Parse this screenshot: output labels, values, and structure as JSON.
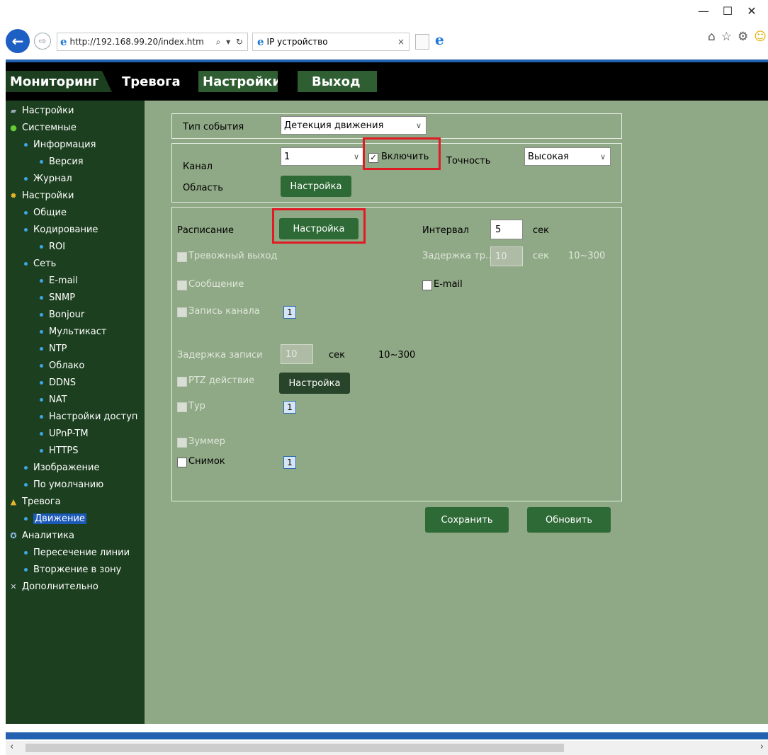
{
  "browser": {
    "url": "http://192.168.99.20/index.htm",
    "tab_title": "IP устройство",
    "tab_close": "×",
    "minimize": "—",
    "maximize": "☐",
    "close": "✕",
    "icons": [
      "home-icon",
      "star-icon",
      "gear-icon",
      "smiley-icon"
    ]
  },
  "nav": {
    "tabs": [
      {
        "label": "Мониторинг"
      },
      {
        "label": "Тревога"
      },
      {
        "label": "Настройки"
      },
      {
        "label": "Выход"
      }
    ]
  },
  "sidebar": {
    "items": [
      {
        "label": "Настройки",
        "level": 0,
        "icon": "book-icon"
      },
      {
        "label": "Системные",
        "level": 0,
        "icon": "info-icon"
      },
      {
        "label": "Информация",
        "level": 1
      },
      {
        "label": "Версия",
        "level": 2
      },
      {
        "label": "Журнал",
        "level": 1
      },
      {
        "label": "Настройки",
        "level": 0,
        "icon": "gear-icon"
      },
      {
        "label": "Общие",
        "level": 1
      },
      {
        "label": "Кодирование",
        "level": 1
      },
      {
        "label": "ROI",
        "level": 2
      },
      {
        "label": "Сеть",
        "level": 1
      },
      {
        "label": "E-mail",
        "level": 2
      },
      {
        "label": "SNMP",
        "level": 2
      },
      {
        "label": "Bonjour",
        "level": 2
      },
      {
        "label": "Мультикаст",
        "level": 2
      },
      {
        "label": "NTP",
        "level": 2
      },
      {
        "label": "Облако",
        "level": 2
      },
      {
        "label": "DDNS",
        "level": 2
      },
      {
        "label": "NAT",
        "level": 2
      },
      {
        "label": "Настройки доступ",
        "level": 2
      },
      {
        "label": "UPnP-TM",
        "level": 2
      },
      {
        "label": "HTTPS",
        "level": 2
      },
      {
        "label": "Изображение",
        "level": 1
      },
      {
        "label": "По умолчанию",
        "level": 1
      },
      {
        "label": "Тревога",
        "level": 0,
        "icon": "bell-icon"
      },
      {
        "label": "Движение",
        "level": 1,
        "selected": true
      },
      {
        "label": "Аналитика",
        "level": 0,
        "icon": "analytics-icon"
      },
      {
        "label": "Пересечение линии",
        "level": 1
      },
      {
        "label": "Вторжение в зону",
        "level": 1
      },
      {
        "label": "Дополнительно",
        "level": 0,
        "icon": "tools-icon"
      }
    ]
  },
  "form": {
    "event_type_label": "Тип события",
    "event_type_value": "Детекция движения",
    "channel_label": "Канал",
    "channel_value": "1",
    "enable_label": "Включить",
    "enable_checked": true,
    "accuracy_label": "Точность",
    "accuracy_value": "Высокая",
    "area_label": "Область",
    "area_button": "Настройка",
    "schedule_label": "Расписание",
    "schedule_button": "Настройка",
    "interval_label": "Интервал",
    "interval_value": "5",
    "interval_unit": "сек",
    "alarm_out_label": "Тревожный выход",
    "delay_label": "Задержка тр...",
    "delay_value": "10",
    "delay_unit": "сек",
    "delay_range": "10~300",
    "message_label": "Сообщение",
    "email_label": "E-mail",
    "record_channel_label": "Запись канала",
    "record_channel_value": "1",
    "record_delay_label": "Задержка записи",
    "record_delay_value": "10",
    "record_delay_unit": "сек",
    "record_delay_range": "10~300",
    "ptz_label": "PTZ действие",
    "ptz_button": "Настройка",
    "tour_label": "Тур",
    "tour_value": "1",
    "buzzer_label": "Зуммер",
    "snapshot_label": "Снимок",
    "snapshot_value": "1",
    "save_button": "Сохранить",
    "refresh_button": "Обновить"
  },
  "colors": {
    "content_bg": "#8fa885",
    "sidebar_bg": "#1c3f1f",
    "button_green": "#2e6a36",
    "highlight_red": "#e01b24",
    "accent_blue": "#2362b0"
  }
}
